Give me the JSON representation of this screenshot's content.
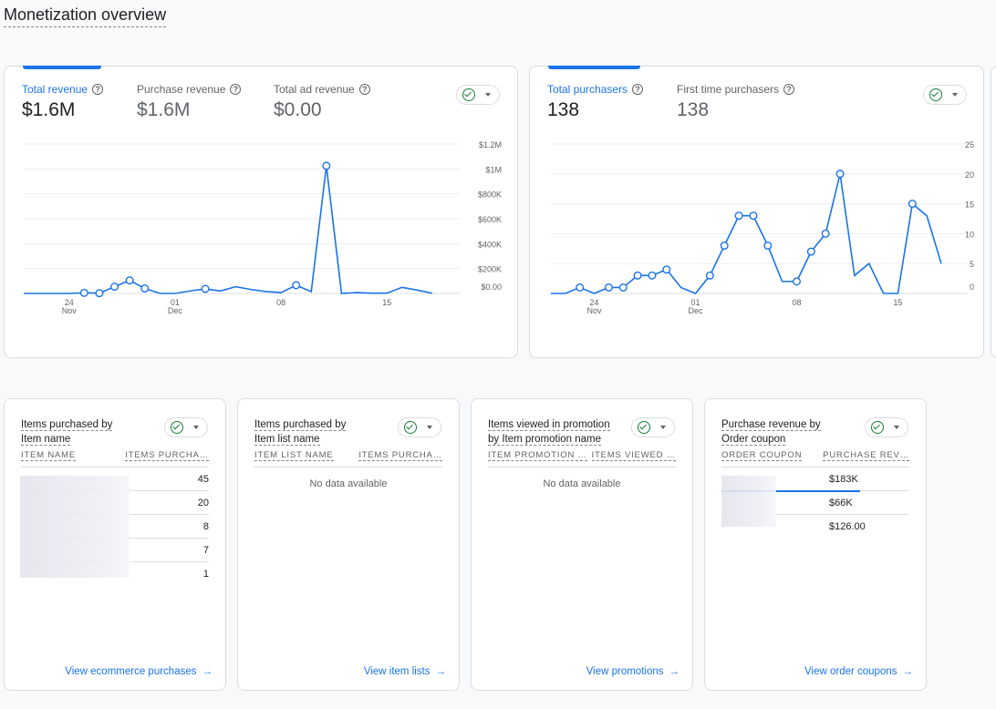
{
  "page_title": "Monetization overview",
  "colors": {
    "accent": "#1a73e8",
    "check": "#188038"
  },
  "revenue_card": {
    "metrics": [
      {
        "label": "Total revenue",
        "value": "$1.6M",
        "active": true
      },
      {
        "label": "Purchase revenue",
        "value": "$1.6M"
      },
      {
        "label": "Total ad revenue",
        "value": "$0.00"
      }
    ],
    "compare_icon": "check-circle-icon"
  },
  "purchasers_card": {
    "metrics": [
      {
        "label": "Total purchasers",
        "value": "138",
        "active": true
      },
      {
        "label": "First time purchasers",
        "value": "138"
      }
    ],
    "compare_icon": "check-circle-icon"
  },
  "chart_data": [
    {
      "type": "line",
      "x_ticks": [
        {
          "day": "24",
          "month": "Nov"
        },
        {
          "day": "01",
          "month": "Dec"
        },
        {
          "day": "08",
          "month": ""
        },
        {
          "day": "15",
          "month": ""
        }
      ],
      "x": [
        "Nov 21",
        "Nov 22",
        "Nov 23",
        "Nov 24",
        "Nov 25",
        "Nov 26",
        "Nov 27",
        "Nov 28",
        "Nov 29",
        "Nov 30",
        "Dec 1",
        "Dec 2",
        "Dec 3",
        "Dec 4",
        "Dec 5",
        "Dec 6",
        "Dec 7",
        "Dec 8",
        "Dec 9",
        "Dec 10",
        "Dec 11",
        "Dec 12",
        "Dec 13",
        "Dec 14",
        "Dec 15",
        "Dec 16",
        "Dec 17",
        "Dec 18"
      ],
      "values": [
        0,
        0,
        0,
        0,
        5000,
        2000,
        54000,
        105000,
        40000,
        0,
        0,
        20000,
        37000,
        20000,
        54000,
        32000,
        15000,
        7000,
        66000,
        15000,
        1025000,
        0,
        7000,
        2000,
        2000,
        49000,
        27000,
        2000
      ],
      "markers": [
        4,
        5,
        6,
        7,
        8,
        12,
        18,
        20
      ],
      "y_ticks": [
        "$0.00",
        "$200K",
        "$400K",
        "$600K",
        "$800K",
        "$1M",
        "$1.2M"
      ],
      "ylim": [
        0,
        1200000
      ],
      "grid": true,
      "y_axis": "right"
    },
    {
      "type": "line",
      "x_ticks": [
        {
          "day": "24",
          "month": "Nov"
        },
        {
          "day": "01",
          "month": "Dec"
        },
        {
          "day": "08",
          "month": ""
        },
        {
          "day": "15",
          "month": ""
        }
      ],
      "x": [
        "Nov 21",
        "Nov 22",
        "Nov 23",
        "Nov 24",
        "Nov 25",
        "Nov 26",
        "Nov 27",
        "Nov 28",
        "Nov 29",
        "Nov 30",
        "Dec 1",
        "Dec 2",
        "Dec 3",
        "Dec 4",
        "Dec 5",
        "Dec 6",
        "Dec 7",
        "Dec 8",
        "Dec 9",
        "Dec 10",
        "Dec 11",
        "Dec 12",
        "Dec 13",
        "Dec 14",
        "Dec 15",
        "Dec 16",
        "Dec 17",
        "Dec 18"
      ],
      "values": [
        0,
        0,
        1,
        0,
        1,
        1,
        3,
        3,
        4,
        1,
        0,
        3,
        8,
        13,
        13,
        8,
        2,
        2,
        7,
        10,
        20,
        3,
        5,
        0,
        0,
        15,
        13,
        5
      ],
      "markers": [
        2,
        4,
        5,
        6,
        7,
        8,
        11,
        12,
        13,
        14,
        15,
        17,
        18,
        19,
        20,
        25
      ],
      "y_ticks": [
        "0",
        "5",
        "10",
        "15",
        "20",
        "25"
      ],
      "ylim": [
        0,
        25
      ],
      "grid": true,
      "y_axis": "right"
    }
  ],
  "tables": [
    {
      "title_a": "Items purchased by",
      "title_b": "Item name",
      "col1": "ITEM NAME",
      "col2": "ITEMS PURCHA…",
      "rows": [
        "45",
        "20",
        "8",
        "7",
        "1"
      ],
      "link": "View ecommerce purchases"
    },
    {
      "title_a": "Items purchased by",
      "title_b": "Item list name",
      "col1": "ITEM LIST NAME",
      "col2": "ITEMS PURCHA…",
      "empty": "No data available",
      "link": "View item lists"
    },
    {
      "title_a": "Items viewed in promotion",
      "title_b": "by Item promotion name",
      "col1": "ITEM PROMOTION …",
      "col2": "ITEMS VIEWED …",
      "empty": "No data available",
      "link": "View promotions"
    },
    {
      "title_a": "Purchase revenue by",
      "title_b": "Order coupon",
      "col1": "ORDER COUPON",
      "col2": "PURCHASE REV…",
      "rows": [
        "$183K",
        "$66K",
        "$126.00"
      ],
      "link": "View order coupons"
    }
  ]
}
